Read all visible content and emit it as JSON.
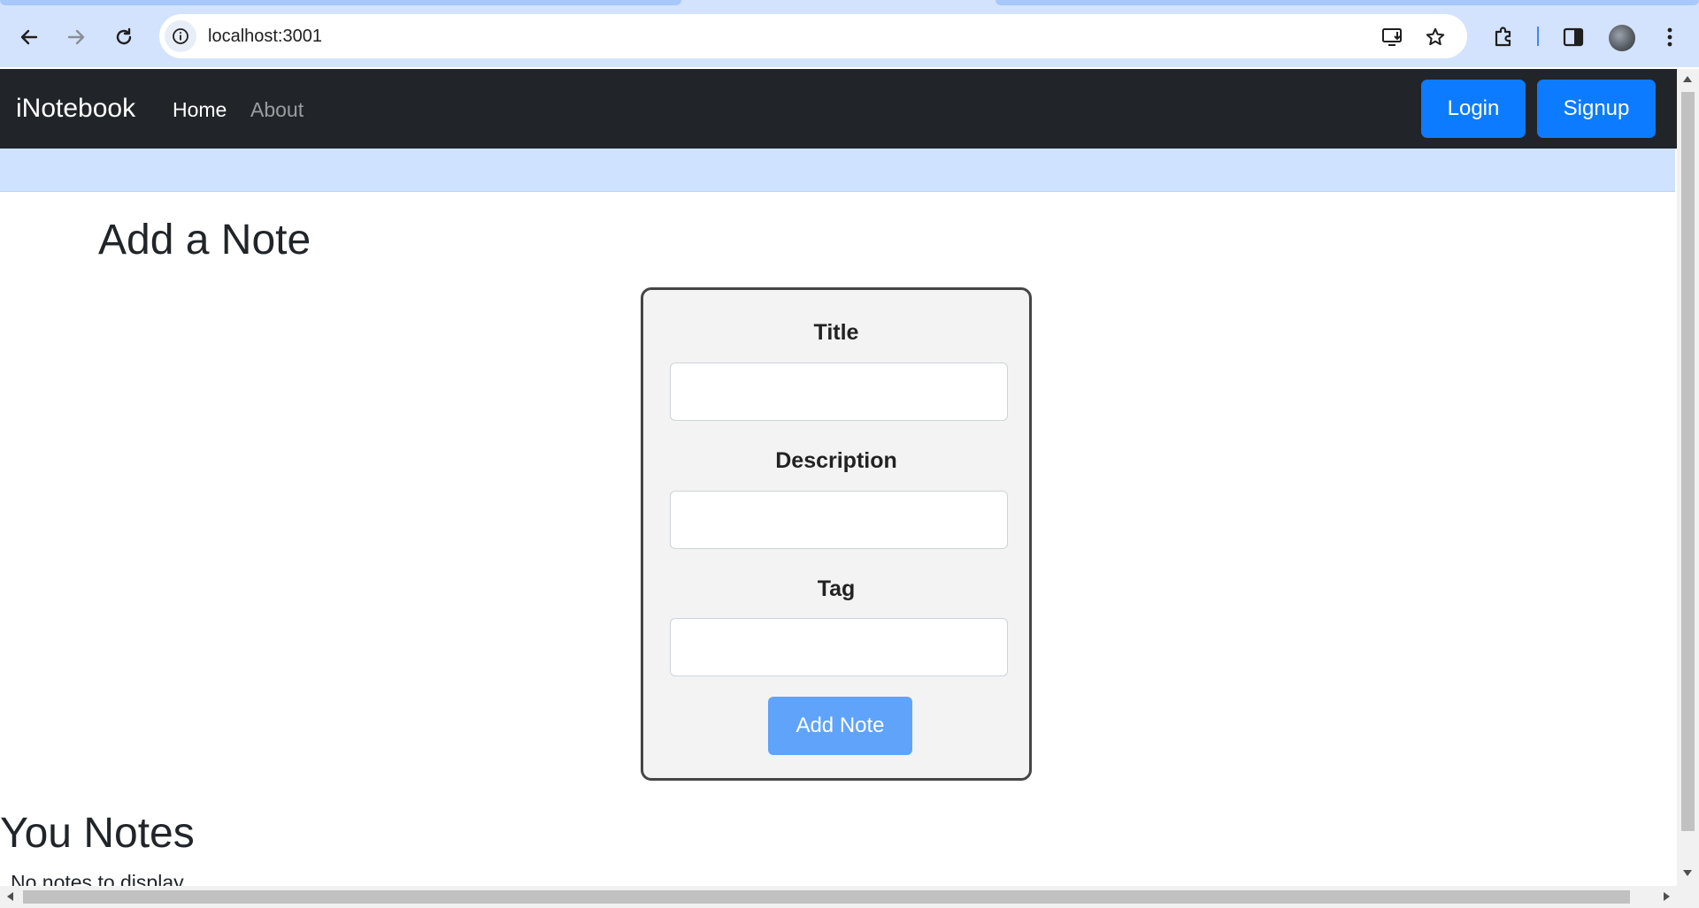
{
  "browser": {
    "url": "localhost:3001"
  },
  "navbar": {
    "brand": "iNotebook",
    "links": [
      "Home",
      "About"
    ],
    "login_label": "Login",
    "signup_label": "Signup"
  },
  "main": {
    "heading": "Add a Note",
    "form": {
      "title_label": "Title",
      "description_label": "Description",
      "tag_label": "Tag",
      "title_value": "",
      "description_value": "",
      "tag_value": "",
      "submit_label": "Add Note"
    },
    "notes_heading": "You Notes",
    "empty_message": "No notes to display"
  },
  "colors": {
    "navbar_bg": "#212529",
    "primary_button": "#0d7bff",
    "disabled_button": "#5fa3fb",
    "alert_bg": "#cfe2ff",
    "card_border": "#454545"
  },
  "icons": [
    "back-arrow-icon",
    "forward-arrow-icon",
    "reload-icon",
    "site-info-icon",
    "install-app-icon",
    "star-icon",
    "extensions-icon",
    "side-panel-icon",
    "avatar",
    "kebab-menu-icon"
  ]
}
